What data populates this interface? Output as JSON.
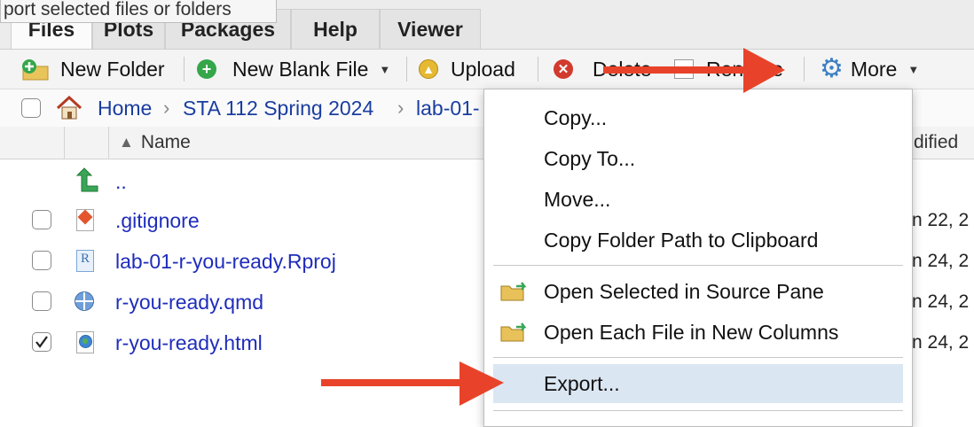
{
  "tooltip": "port selected files or folders",
  "tabs": [
    {
      "label": "Files"
    },
    {
      "label": "Plots"
    },
    {
      "label": "Packages"
    },
    {
      "label": "Help"
    },
    {
      "label": "Viewer"
    }
  ],
  "toolbar": {
    "new_folder": "New Folder",
    "new_blank_file": "New Blank File",
    "upload": "Upload",
    "delete": "Delete",
    "rename": "Rename",
    "more": "More"
  },
  "breadcrumb": {
    "home": "Home",
    "course": "STA 112 Spring 2024",
    "current": "lab-01-"
  },
  "table": {
    "name_header": "Name",
    "modified_header": "dified",
    "rows": [
      {
        "name": "..",
        "date": "",
        "checked": false
      },
      {
        "name": ".gitignore",
        "date": "n 22, 2",
        "checked": false
      },
      {
        "name": "lab-01-r-you-ready.Rproj",
        "date": "n 24, 2",
        "checked": false
      },
      {
        "name": "r-you-ready.qmd",
        "date": "n 24, 2",
        "checked": false
      },
      {
        "name": "r-you-ready.html",
        "date": "n 24, 2",
        "checked": true
      }
    ]
  },
  "menu": {
    "items": [
      {
        "label": "Copy..."
      },
      {
        "label": "Copy To..."
      },
      {
        "label": "Move..."
      },
      {
        "label": "Copy Folder Path to Clipboard"
      },
      {
        "label": "Open Selected in Source Pane"
      },
      {
        "label": "Open Each File in New Columns"
      },
      {
        "label": "Export..."
      }
    ],
    "highlighted": "Export..."
  },
  "colors": {
    "link": "#1f2dbb",
    "highlight": "#dbe6f3",
    "arrow": "#e8432a"
  }
}
